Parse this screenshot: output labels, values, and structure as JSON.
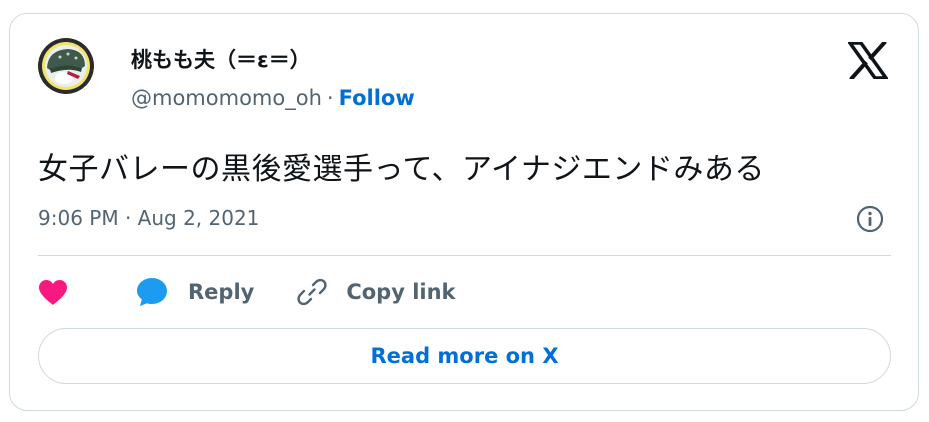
{
  "author": {
    "display_name": "桃もも夫（＝ε＝）",
    "handle": "@momomomo_oh",
    "separator": "·",
    "follow_label": "Follow"
  },
  "tweet": {
    "text": "女子バレーの黒後愛選手って、アイナジエンドみある",
    "timestamp": "9:06 PM · Aug 2, 2021"
  },
  "actions": {
    "reply_label": "Reply",
    "copy_link_label": "Copy link"
  },
  "read_more_label": "Read more on X",
  "colors": {
    "like": "#f91880",
    "reply": "#1d9bf0",
    "link": "#006fd6",
    "muted": "#536471",
    "border": "#cfd9de"
  },
  "icons": [
    "avatar",
    "x-logo-icon",
    "info-icon",
    "heart-icon",
    "reply-bubble-icon",
    "link-icon"
  ]
}
